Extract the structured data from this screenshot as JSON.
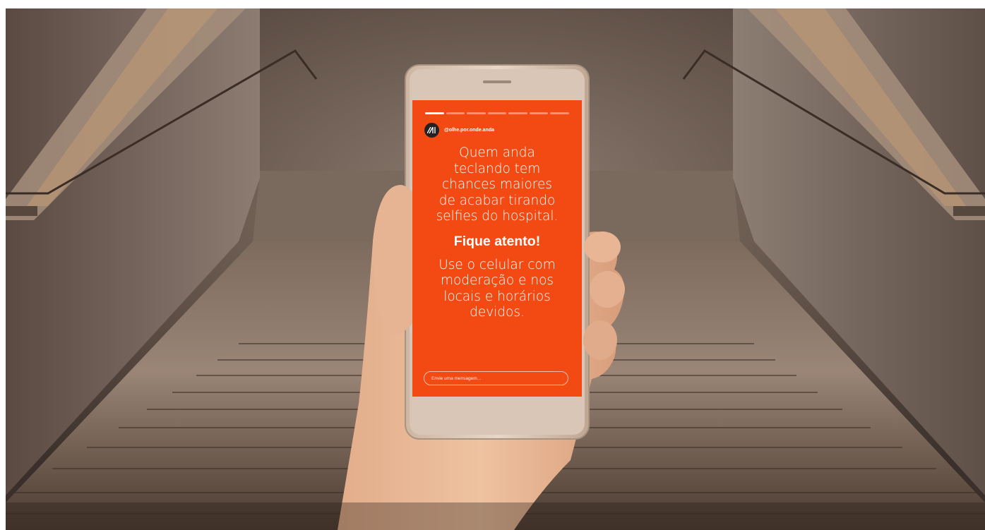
{
  "story": {
    "handle": "@olhe.por.onde.anda",
    "avatar_initials": "/A1",
    "progress_segments": 7,
    "active_segment": 1,
    "paragraph_1": "Quem anda\nteclando tem\nchances maiores\nde acabar tirando\nselfies do hospital.",
    "emphasis": "Fique atento!",
    "paragraph_2": "Use o celular com\nmoderação e nos\nlocais e horários\ndevidos.",
    "message_placeholder": "Envie uma mensagem..."
  },
  "colors": {
    "screen_orange": "#f24a12",
    "text": "#ffffff"
  },
  "icons": {
    "avatar": "brand-logo-icon"
  }
}
